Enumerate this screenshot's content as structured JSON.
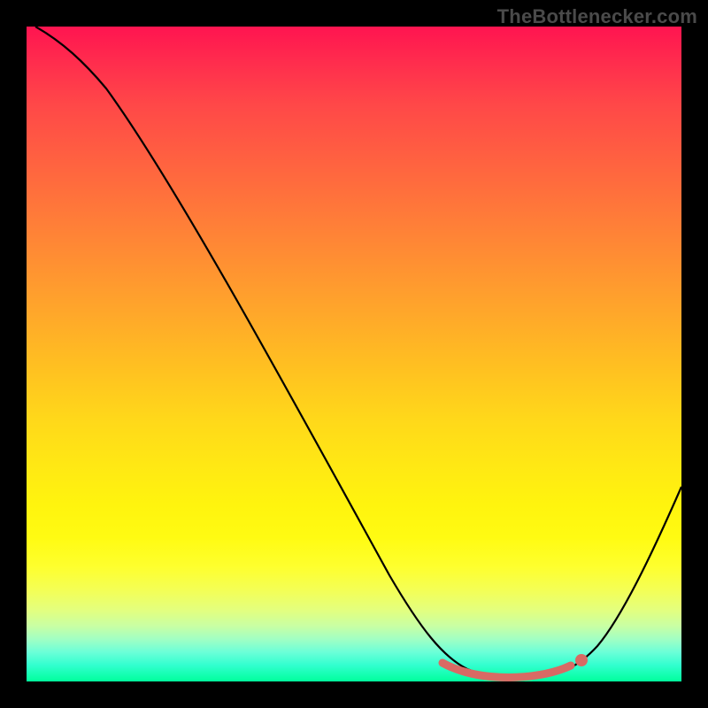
{
  "watermark": "TheBottlenecker.com",
  "chart_data": {
    "type": "line",
    "title": "",
    "xlabel": "",
    "ylabel": "",
    "xlim": [
      0,
      100
    ],
    "ylim": [
      0,
      100
    ],
    "x": [
      0,
      5,
      10,
      15,
      20,
      25,
      30,
      35,
      40,
      45,
      50,
      55,
      58,
      61,
      64,
      67,
      70,
      73,
      76,
      79,
      82,
      85,
      88,
      91,
      94,
      97,
      100
    ],
    "y": [
      100,
      99,
      96,
      91,
      83,
      74,
      65,
      56,
      47,
      38,
      29,
      20,
      15,
      11,
      7,
      4,
      2.2,
      1.2,
      0.7,
      0.6,
      1,
      2.4,
      5,
      9,
      14.5,
      21,
      28
    ],
    "series": [
      {
        "name": "bottleneck-curve",
        "color": "#000000"
      }
    ],
    "highlight_region": {
      "x_start": 64,
      "x_end": 84,
      "color": "#d86a64"
    },
    "marker": {
      "x": 84,
      "y": 2.0,
      "color": "#d86a64"
    },
    "background_gradient": {
      "top": "#ff1450",
      "mid": "#ffe814",
      "bottom": "#00ff9c"
    }
  }
}
